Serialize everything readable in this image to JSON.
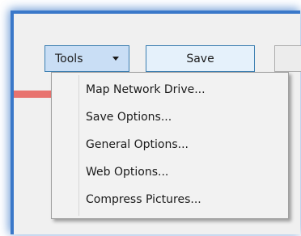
{
  "toolbar": {
    "tools_label": "Tools",
    "save_label": "Save"
  },
  "tools_menu": {
    "items": [
      {
        "label": "Map Network Drive..."
      },
      {
        "label": "Save Options..."
      },
      {
        "label": "General Options..."
      },
      {
        "label": "Web Options..."
      },
      {
        "label": "Compress Pictures..."
      }
    ]
  },
  "colors": {
    "frame_border": "#3a78c9",
    "tools_button_bg": "#c9def5",
    "save_button_bg": "#e5f1fb",
    "button_border": "#3c7fb1",
    "menu_bg": "#f2f2f2",
    "red_strip": "#e8736f"
  }
}
